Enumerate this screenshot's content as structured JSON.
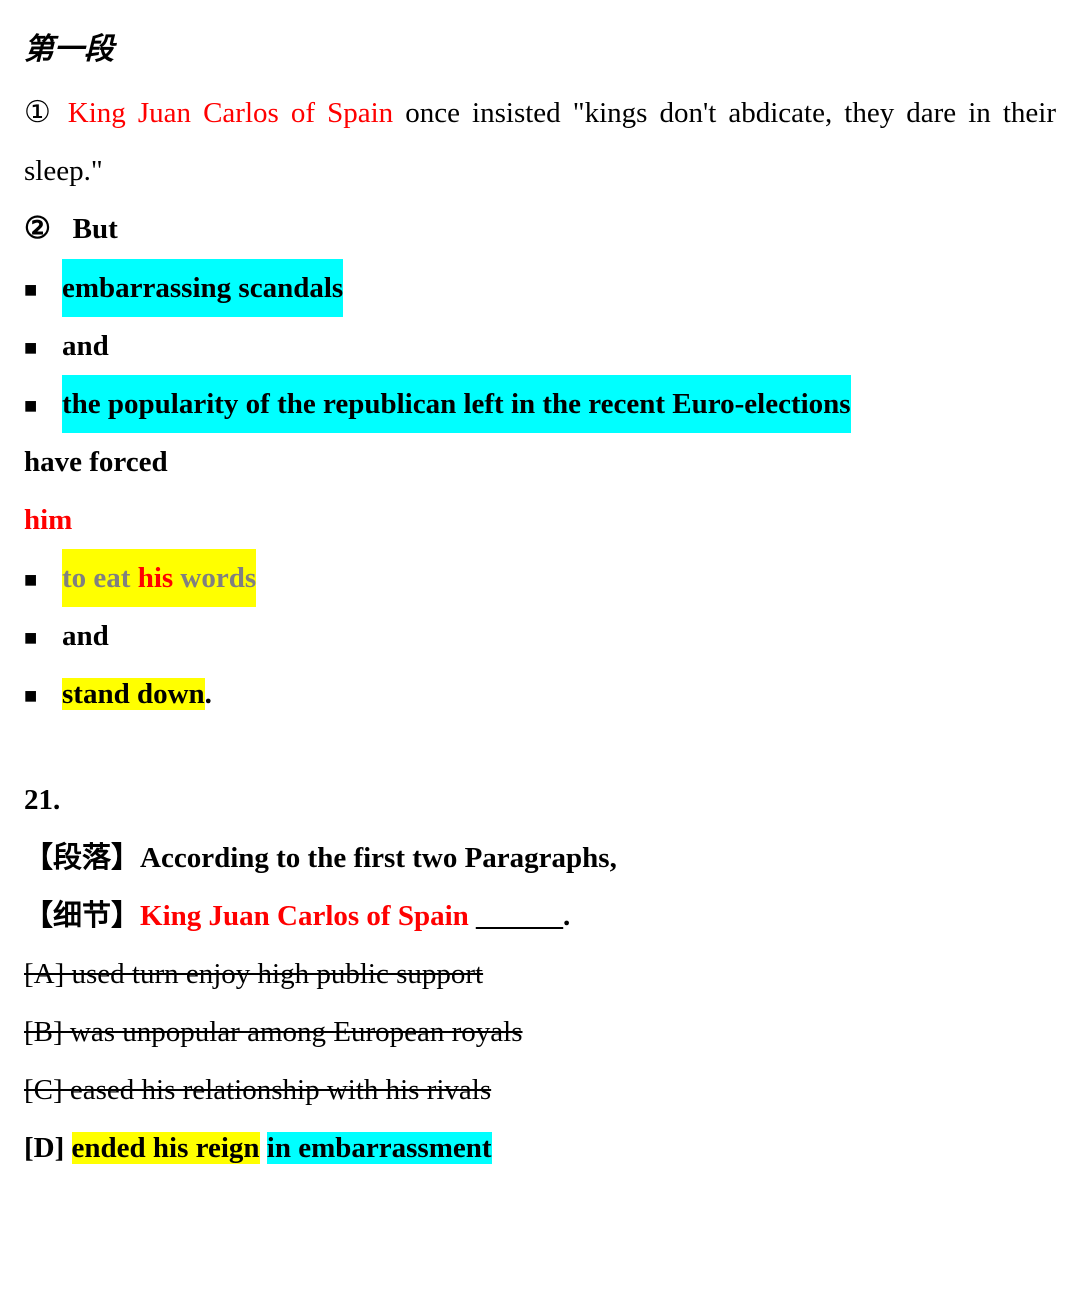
{
  "heading": "第一段",
  "s1": {
    "num": "①",
    "part_a": "King Juan Carlos of Spain",
    "part_b": " once insisted \"kings don't abdicate, they dare in their sleep.\""
  },
  "s2": {
    "num": "②",
    "but": "But",
    "b1": "embarrassing scandals",
    "b2": "and",
    "b3": "the popularity of the republican left in the recent Euro-elections",
    "forced": "have forced",
    "him": "him",
    "eat_pre": "to eat ",
    "eat_mid": "his",
    "eat_post": " words",
    "and2": "and",
    "stand": "stand down",
    "period": "."
  },
  "q": {
    "num": "21.",
    "tag_para": "【段落】",
    "para_text": "According to the first two Paragraphs,",
    "tag_detail": "【细节】",
    "detail_text": "King Juan Carlos of Spain",
    "blank": " ______.",
    "optA": "[A] used turn enjoy high public support",
    "optB": "[B] was unpopular among European royals",
    "optC": "[C] eased his relationship with his rivals",
    "optD_label": "[D] ",
    "optD_p1": "ended his reign",
    "optD_sp": " ",
    "optD_p2": "in embarrassment"
  }
}
